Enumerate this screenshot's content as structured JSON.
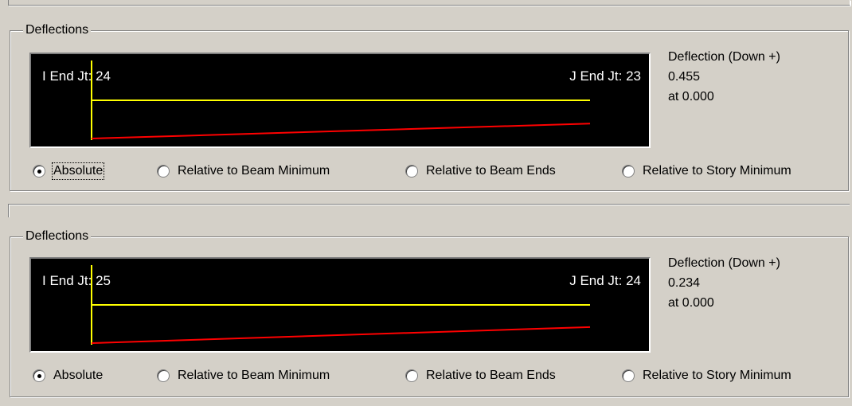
{
  "panels": [
    {
      "group_label": "Deflections",
      "i_end_label": "I End Jt: 24",
      "j_end_label": "J End Jt: 23",
      "readout_title": "Deflection (Down +)",
      "readout_value": "0.455",
      "readout_location": "at 0.000",
      "options": [
        {
          "label": "Absolute",
          "checked": true
        },
        {
          "label": "Relative to Beam Minimum",
          "checked": false
        },
        {
          "label": "Relative to Beam Ends",
          "checked": false
        },
        {
          "label": "Relative to Story Minimum",
          "checked": false
        }
      ],
      "deflection_start_fraction": 1.0,
      "deflection_end_fraction": 0.61
    },
    {
      "group_label": "Deflections",
      "i_end_label": "I End Jt: 25",
      "j_end_label": "J End Jt: 24",
      "readout_title": "Deflection (Down +)",
      "readout_value": "0.234",
      "readout_location": "at 0.000",
      "options": [
        {
          "label": "Absolute",
          "checked": true
        },
        {
          "label": "Relative to Beam Minimum",
          "checked": false
        },
        {
          "label": "Relative to Beam Ends",
          "checked": false
        },
        {
          "label": "Relative to Story Minimum",
          "checked": false
        }
      ],
      "deflection_start_fraction": 1.0,
      "deflection_end_fraction": 0.58
    }
  ],
  "colors": {
    "plot_background": "#000000",
    "reference_line": "#ffff00",
    "deflection_line": "#ff0000",
    "plot_text": "#ffffff"
  }
}
